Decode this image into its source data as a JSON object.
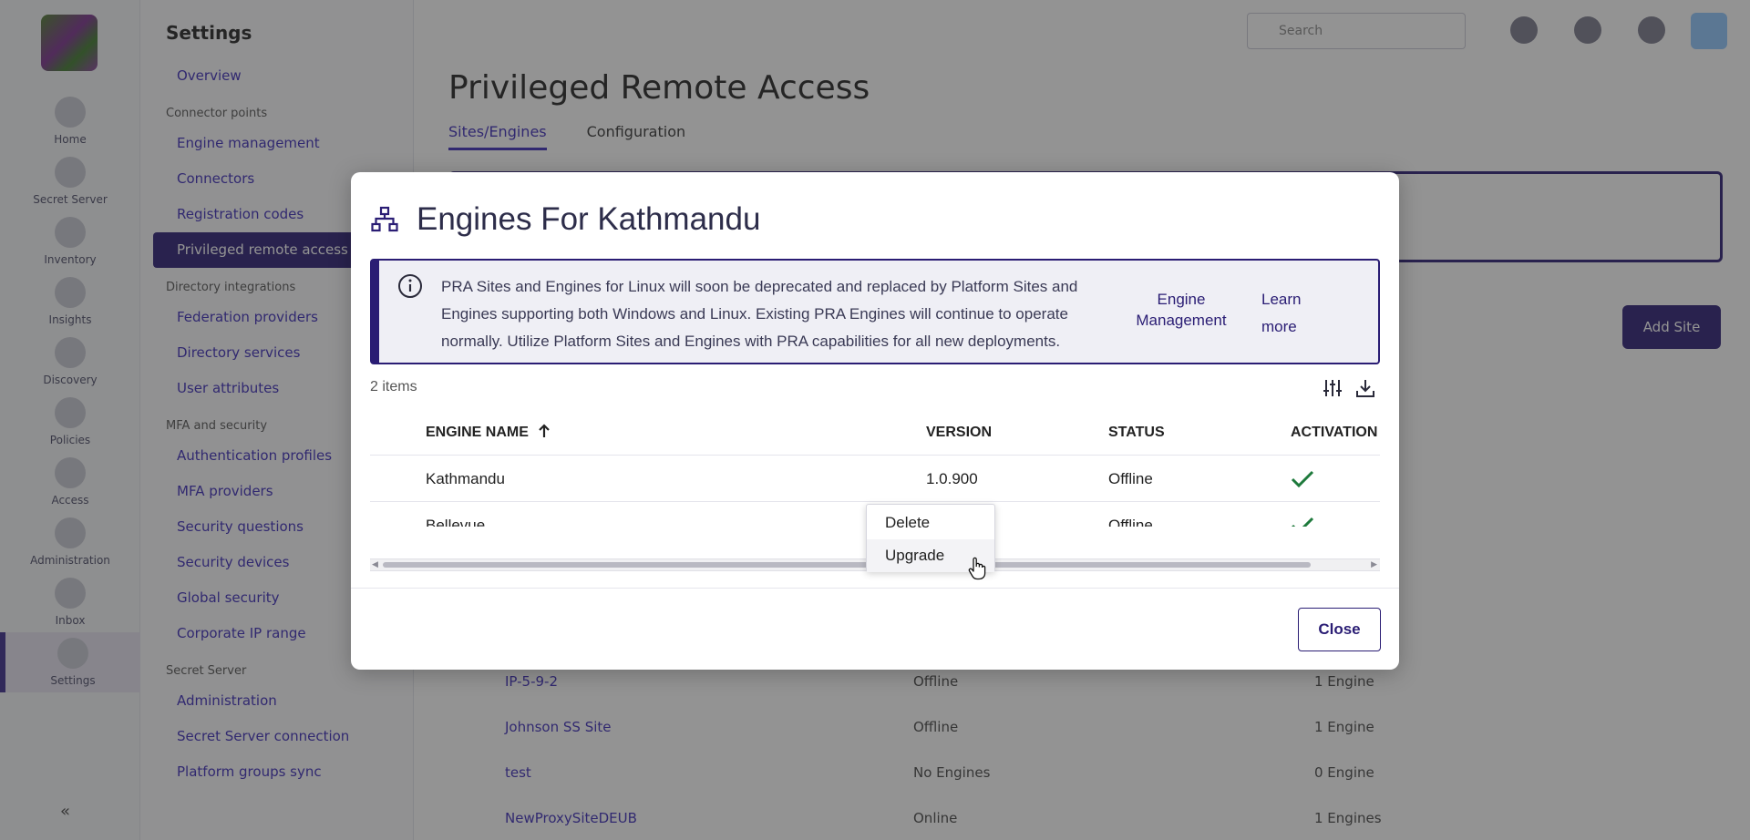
{
  "background": {
    "rail": [
      {
        "label": "Home"
      },
      {
        "label": "Secret Server"
      },
      {
        "label": "Inventory"
      },
      {
        "label": "Insights"
      },
      {
        "label": "Discovery"
      },
      {
        "label": "Policies"
      },
      {
        "label": "Access"
      },
      {
        "label": "Administration"
      },
      {
        "label": "Inbox"
      },
      {
        "label": "Settings"
      }
    ],
    "settings_title": "Settings",
    "nav": {
      "overview": "Overview",
      "group_connectors": "Connector points",
      "engine_management": "Engine management",
      "connectors": "Connectors",
      "registration_codes": "Registration codes",
      "pra": "Privileged remote access",
      "group_directory": "Directory integrations",
      "federation": "Federation providers",
      "directory_services": "Directory services",
      "user_attributes": "User attributes",
      "group_mfa": "MFA and security",
      "auth_profiles": "Authentication profiles",
      "mfa_providers": "MFA providers",
      "security_questions": "Security questions",
      "security_devices": "Security devices",
      "global_security": "Global security",
      "corporate_ip": "Corporate IP range",
      "group_secret": "Secret Server",
      "administration": "Administration",
      "ss_connection": "Secret Server connection",
      "platform_groups": "Platform groups sync"
    },
    "search_placeholder": "Search",
    "page_title": "Privileged Remote Access",
    "tabs": [
      "Sites/Engines",
      "Configuration"
    ],
    "add_site": "Add Site",
    "rows": [
      {
        "name": "IP-5-9-2",
        "status": "Offline",
        "engines": "1 Engine"
      },
      {
        "name": "Johnson SS Site",
        "status": "Offline",
        "engines": "1 Engine"
      },
      {
        "name": "test",
        "status": "No Engines",
        "engines": "0 Engine"
      },
      {
        "name": "NewProxySiteDEUB",
        "status": "Online",
        "engines": "1 Engines"
      }
    ]
  },
  "dialog": {
    "title": "Engines For Kathmandu",
    "notice": {
      "text": "PRA Sites and Engines for Linux will soon be deprecated and replaced by Platform Sites and Engines supporting both Windows and Linux. Existing PRA Engines will continue to operate normally. Utilize Platform Sites and Engines with PRA capabilities for all new deployments.",
      "link_engine": "Engine Management",
      "link_learn": "Learn more"
    },
    "item_count": "2 items",
    "columns": {
      "engine_name": "ENGINE NAME",
      "version": "VERSION",
      "status": "STATUS",
      "activation": "ACTIVATION"
    },
    "rows": [
      {
        "name": "Kathmandu",
        "version": "1.0.900",
        "status": "Offline",
        "activated": true
      },
      {
        "name": "Bellevue",
        "version": "",
        "status": "Offline",
        "activated": true
      }
    ],
    "close_label": "Close",
    "context_menu": [
      "Delete",
      "Upgrade"
    ]
  },
  "colors": {
    "brand": "#2a1d74",
    "link": "#3b2ab8",
    "success": "#1e7a3c",
    "overlay": "rgba(40,40,40,0.5)"
  },
  "icons": {
    "dialog_header": "sitemap-icon",
    "notice": "info-circle-icon",
    "column_settings": "sliders-icon",
    "download": "download-icon",
    "sort": "arrow-up-icon",
    "activation": "check-icon"
  }
}
